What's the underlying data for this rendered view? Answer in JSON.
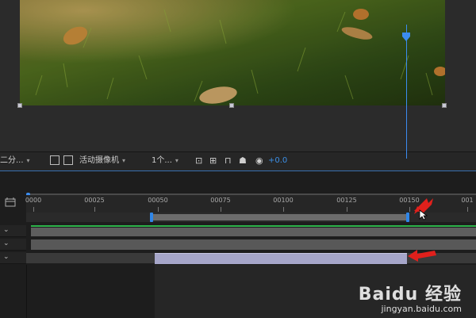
{
  "toolbar": {
    "resolution": "二分...",
    "camera": "活动摄像机",
    "views": "1个...",
    "zoom_value": "+0.0"
  },
  "timeline": {
    "ruler_ticks": [
      "0000",
      "00025",
      "00050",
      "00075",
      "00100",
      "00125",
      "00150",
      "001"
    ]
  },
  "watermark": {
    "brand": "Baidu 经验",
    "site": "jingyan.baidu.com"
  },
  "colors": {
    "accent_blue": "#3b8cf0",
    "layer_green": "#2db34a",
    "selected_layer": "#a6a6c9",
    "annotation_red": "#e0201c"
  }
}
